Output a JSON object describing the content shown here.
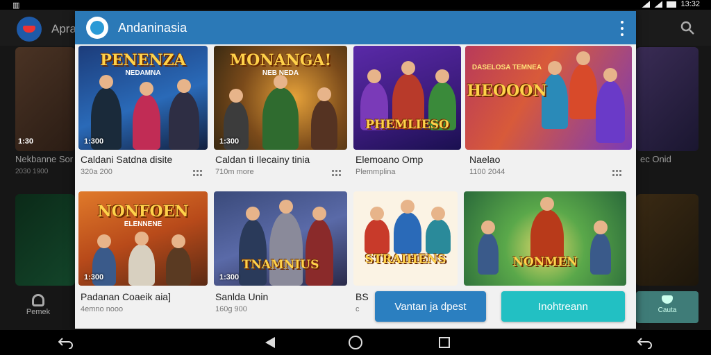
{
  "status_bar": {
    "time": "13:32",
    "left_icon": "notification-icon"
  },
  "background_app": {
    "title": "Apra",
    "left_card_title": "Nekbanne Sor",
    "left_card_meta": "2030 1900",
    "left_card_badge": "1:30",
    "right_card_title": "ec Onid",
    "nav_profile_label": "Pemek",
    "tile_label": "Cauta"
  },
  "dialog": {
    "title": "Andaninasia",
    "menu_icon": "more-vert-icon",
    "tiles": [
      {
        "heading": "PENENZA",
        "subheading": "NEDAMNA",
        "duration": "1:300",
        "title": "Caldani Satdna disite",
        "meta": "320a 200"
      },
      {
        "heading": "MONANGA!",
        "subheading": "NEB NEDA",
        "duration": "1:300",
        "title": "Caldan ti Ilecainy tinia",
        "meta": "710m more"
      },
      {
        "heading": "PHEMLIESO",
        "subheading": "",
        "duration": "",
        "title": "Elemoano Omp",
        "meta": "Plemmplina"
      },
      {
        "heading": "HEOOON",
        "subheading": "DASELOSA TEMNEA",
        "duration": "",
        "title": "Naelao",
        "meta": "1100 2044"
      },
      {
        "heading": "NONFOEN",
        "subheading": "ELENNENE",
        "duration": "1:300",
        "title": "Padanan Coaeik aia]",
        "meta": "4emno nooo"
      },
      {
        "heading": "TNAMNIUS",
        "subheading": "",
        "duration": "1:300",
        "title": "Sanlda Unin",
        "meta": "160g 900"
      },
      {
        "heading": "STRAIHENS",
        "subheading": "",
        "duration": "",
        "title": "BS",
        "meta": "c"
      },
      {
        "heading": "NONMEN",
        "subheading": "",
        "duration": "",
        "title": "",
        "meta": ""
      }
    ],
    "primary_button": "Vantan ja dpest",
    "secondary_button": "Inohtreann"
  },
  "colors": {
    "header_blue": "#2b79b7",
    "primary_button": "#2b7fc0",
    "secondary_button": "#22c0c3"
  }
}
